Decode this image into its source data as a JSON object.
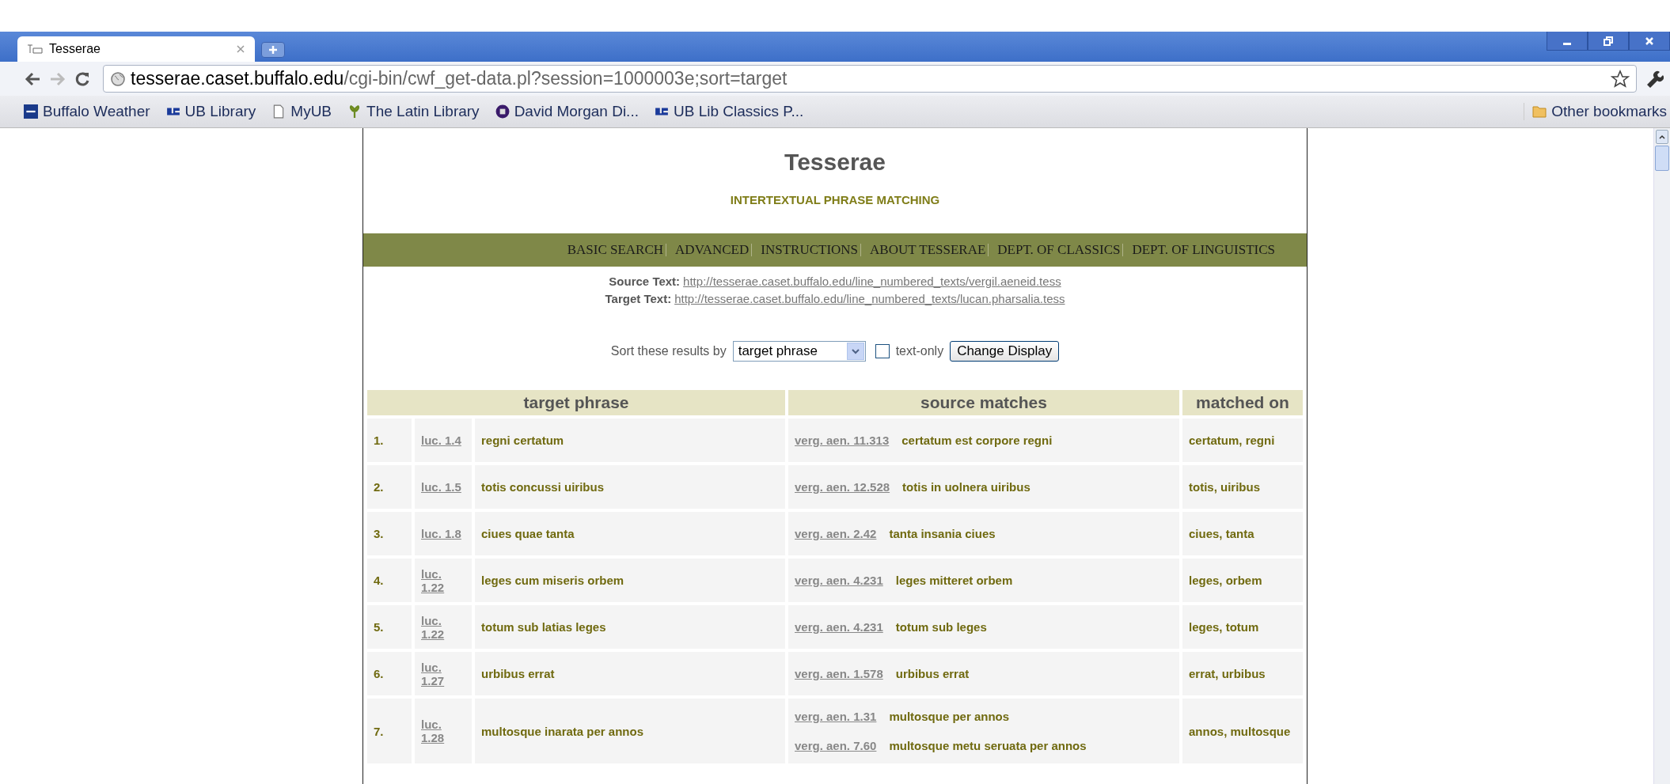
{
  "browser": {
    "tab": {
      "title": "Tesserae",
      "selected": true
    },
    "address": {
      "host": "tesserae.caset.buffalo.edu",
      "path": "/cgi-bin/cwf_get-data.pl?session=1000003e;sort=target"
    },
    "bookmarks": [
      {
        "label": "Buffalo Weather"
      },
      {
        "label": "UB Library"
      },
      {
        "label": "MyUB"
      },
      {
        "label": "The Latin Library"
      },
      {
        "label": "David Morgan Di..."
      },
      {
        "label": "UB Lib Classics P..."
      }
    ],
    "other_bookmarks": "Other bookmarks"
  },
  "page": {
    "title": "Tesserae",
    "subtitle": "INTERTEXTUAL PHRASE MATCHING",
    "nav": [
      "BASIC SEARCH",
      "ADVANCED",
      "INSTRUCTIONS",
      "ABOUT TESSERAE",
      "DEPT. OF CLASSICS",
      "DEPT. OF LINGUISTICS"
    ],
    "source_text": {
      "label": "Source Text:",
      "url": "http://tesserae.caset.buffalo.edu/line_numbered_texts/vergil.aeneid.tess"
    },
    "target_text": {
      "label": "Target Text:",
      "url": "http://tesserae.caset.buffalo.edu/line_numbered_texts/lucan.pharsalia.tess"
    },
    "sort": {
      "label": "Sort these results by",
      "value": "target phrase",
      "text_only": {
        "label": "text-only",
        "checked": false
      },
      "button": "Change Display"
    },
    "table": {
      "columns": [
        "target phrase",
        "source matches",
        "matched on"
      ],
      "rows": [
        {
          "number": "1.",
          "ref": "luc. 1.4",
          "phrase": "regni certatum",
          "sources": [
            {
              "ref": "verg. aen. 11.313",
              "phrase": "certatum est corpore regni"
            }
          ],
          "matched_on": "certatum, regni"
        },
        {
          "number": "2.",
          "ref": "luc. 1.5",
          "phrase": "totis concussi uiribus",
          "sources": [
            {
              "ref": "verg. aen. 12.528",
              "phrase": "totis in uolnera uiribus"
            }
          ],
          "matched_on": "totis, uiribus"
        },
        {
          "number": "3.",
          "ref": "luc. 1.8",
          "phrase": "ciues quae tanta",
          "sources": [
            {
              "ref": "verg. aen. 2.42",
              "phrase": "tanta insania ciues"
            }
          ],
          "matched_on": "ciues, tanta"
        },
        {
          "number": "4.",
          "ref": "luc. 1.22",
          "phrase": "leges cum miseris orbem",
          "sources": [
            {
              "ref": "verg. aen. 4.231",
              "phrase": "leges mitteret orbem"
            }
          ],
          "matched_on": "leges, orbem"
        },
        {
          "number": "5.",
          "ref": "luc. 1.22",
          "phrase": "totum sub latias leges",
          "sources": [
            {
              "ref": "verg. aen. 4.231",
              "phrase": "totum sub leges"
            }
          ],
          "matched_on": "leges, totum"
        },
        {
          "number": "6.",
          "ref": "luc. 1.27",
          "phrase": "urbibus errat",
          "sources": [
            {
              "ref": "verg. aen. 1.578",
              "phrase": "urbibus errat"
            }
          ],
          "matched_on": "errat, urbibus"
        },
        {
          "number": "7.",
          "ref": "luc. 1.28",
          "phrase": "multosque inarata per annos",
          "sources": [
            {
              "ref": "verg. aen. 1.31",
              "phrase": "multosque per annos"
            },
            {
              "ref": "verg. aen. 7.60",
              "phrase": "multosque metu seruata per annos"
            }
          ],
          "matched_on": "annos, multosque"
        }
      ]
    }
  }
}
